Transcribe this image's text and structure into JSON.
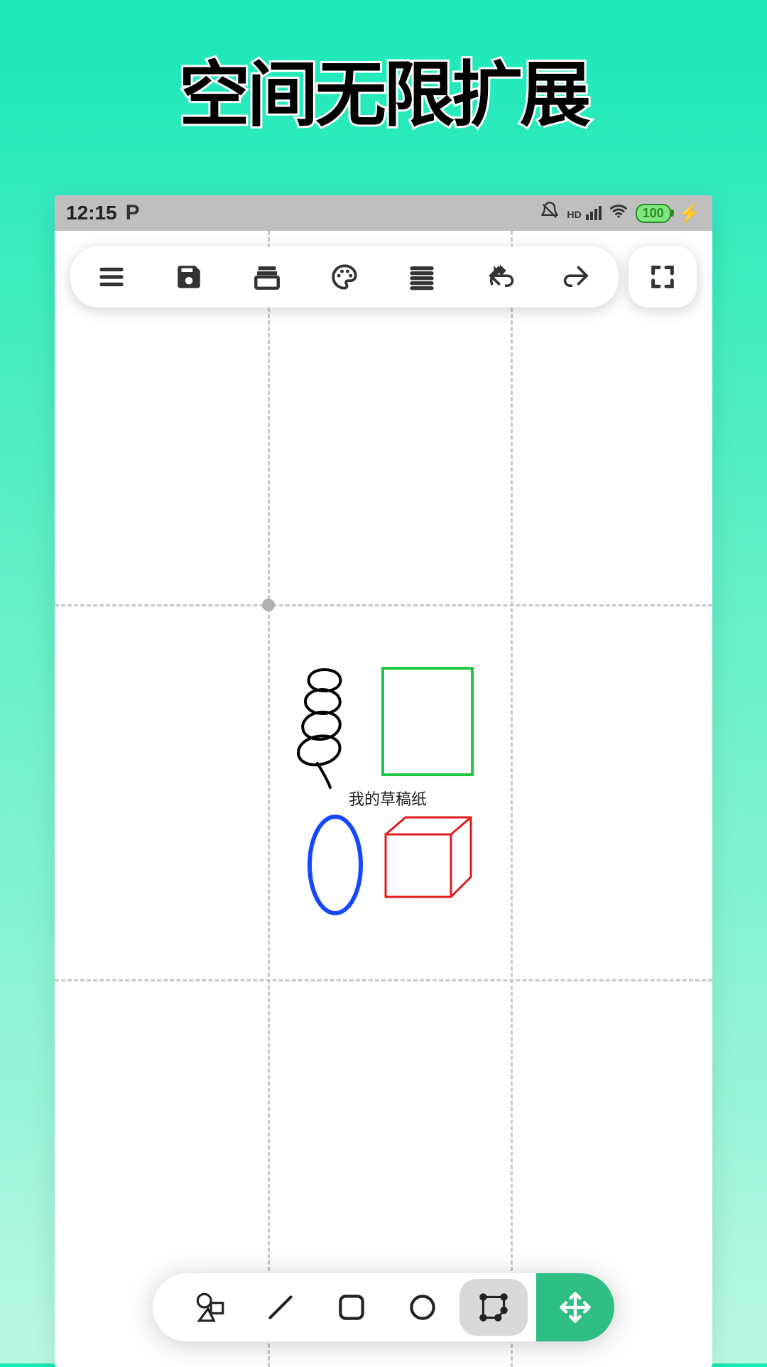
{
  "hero": {
    "title": "空间无限扩展"
  },
  "status": {
    "time": "12:15",
    "carrier_icon": "P",
    "hd_label": "HD",
    "battery": "100"
  },
  "toolbar_top": {
    "menu": "menu",
    "save": "save",
    "layers": "layers",
    "palette": "palette",
    "align": "align-justify",
    "undo": "undo",
    "redo": "redo",
    "fullscreen": "fullscreen"
  },
  "canvas": {
    "text_label": "我的草稿纸",
    "shapes": {
      "scribble_color": "#000000",
      "rect_color": "#1fc742",
      "ellipse_color": "#1548ff",
      "cube_color": "#e01b1b"
    }
  },
  "toolbar_bottom": {
    "shapes": "shapes",
    "line": "line",
    "rect": "rounded-rect",
    "circle": "circle",
    "path_edit": "path-edit",
    "move": "move",
    "selected": "path_edit"
  }
}
